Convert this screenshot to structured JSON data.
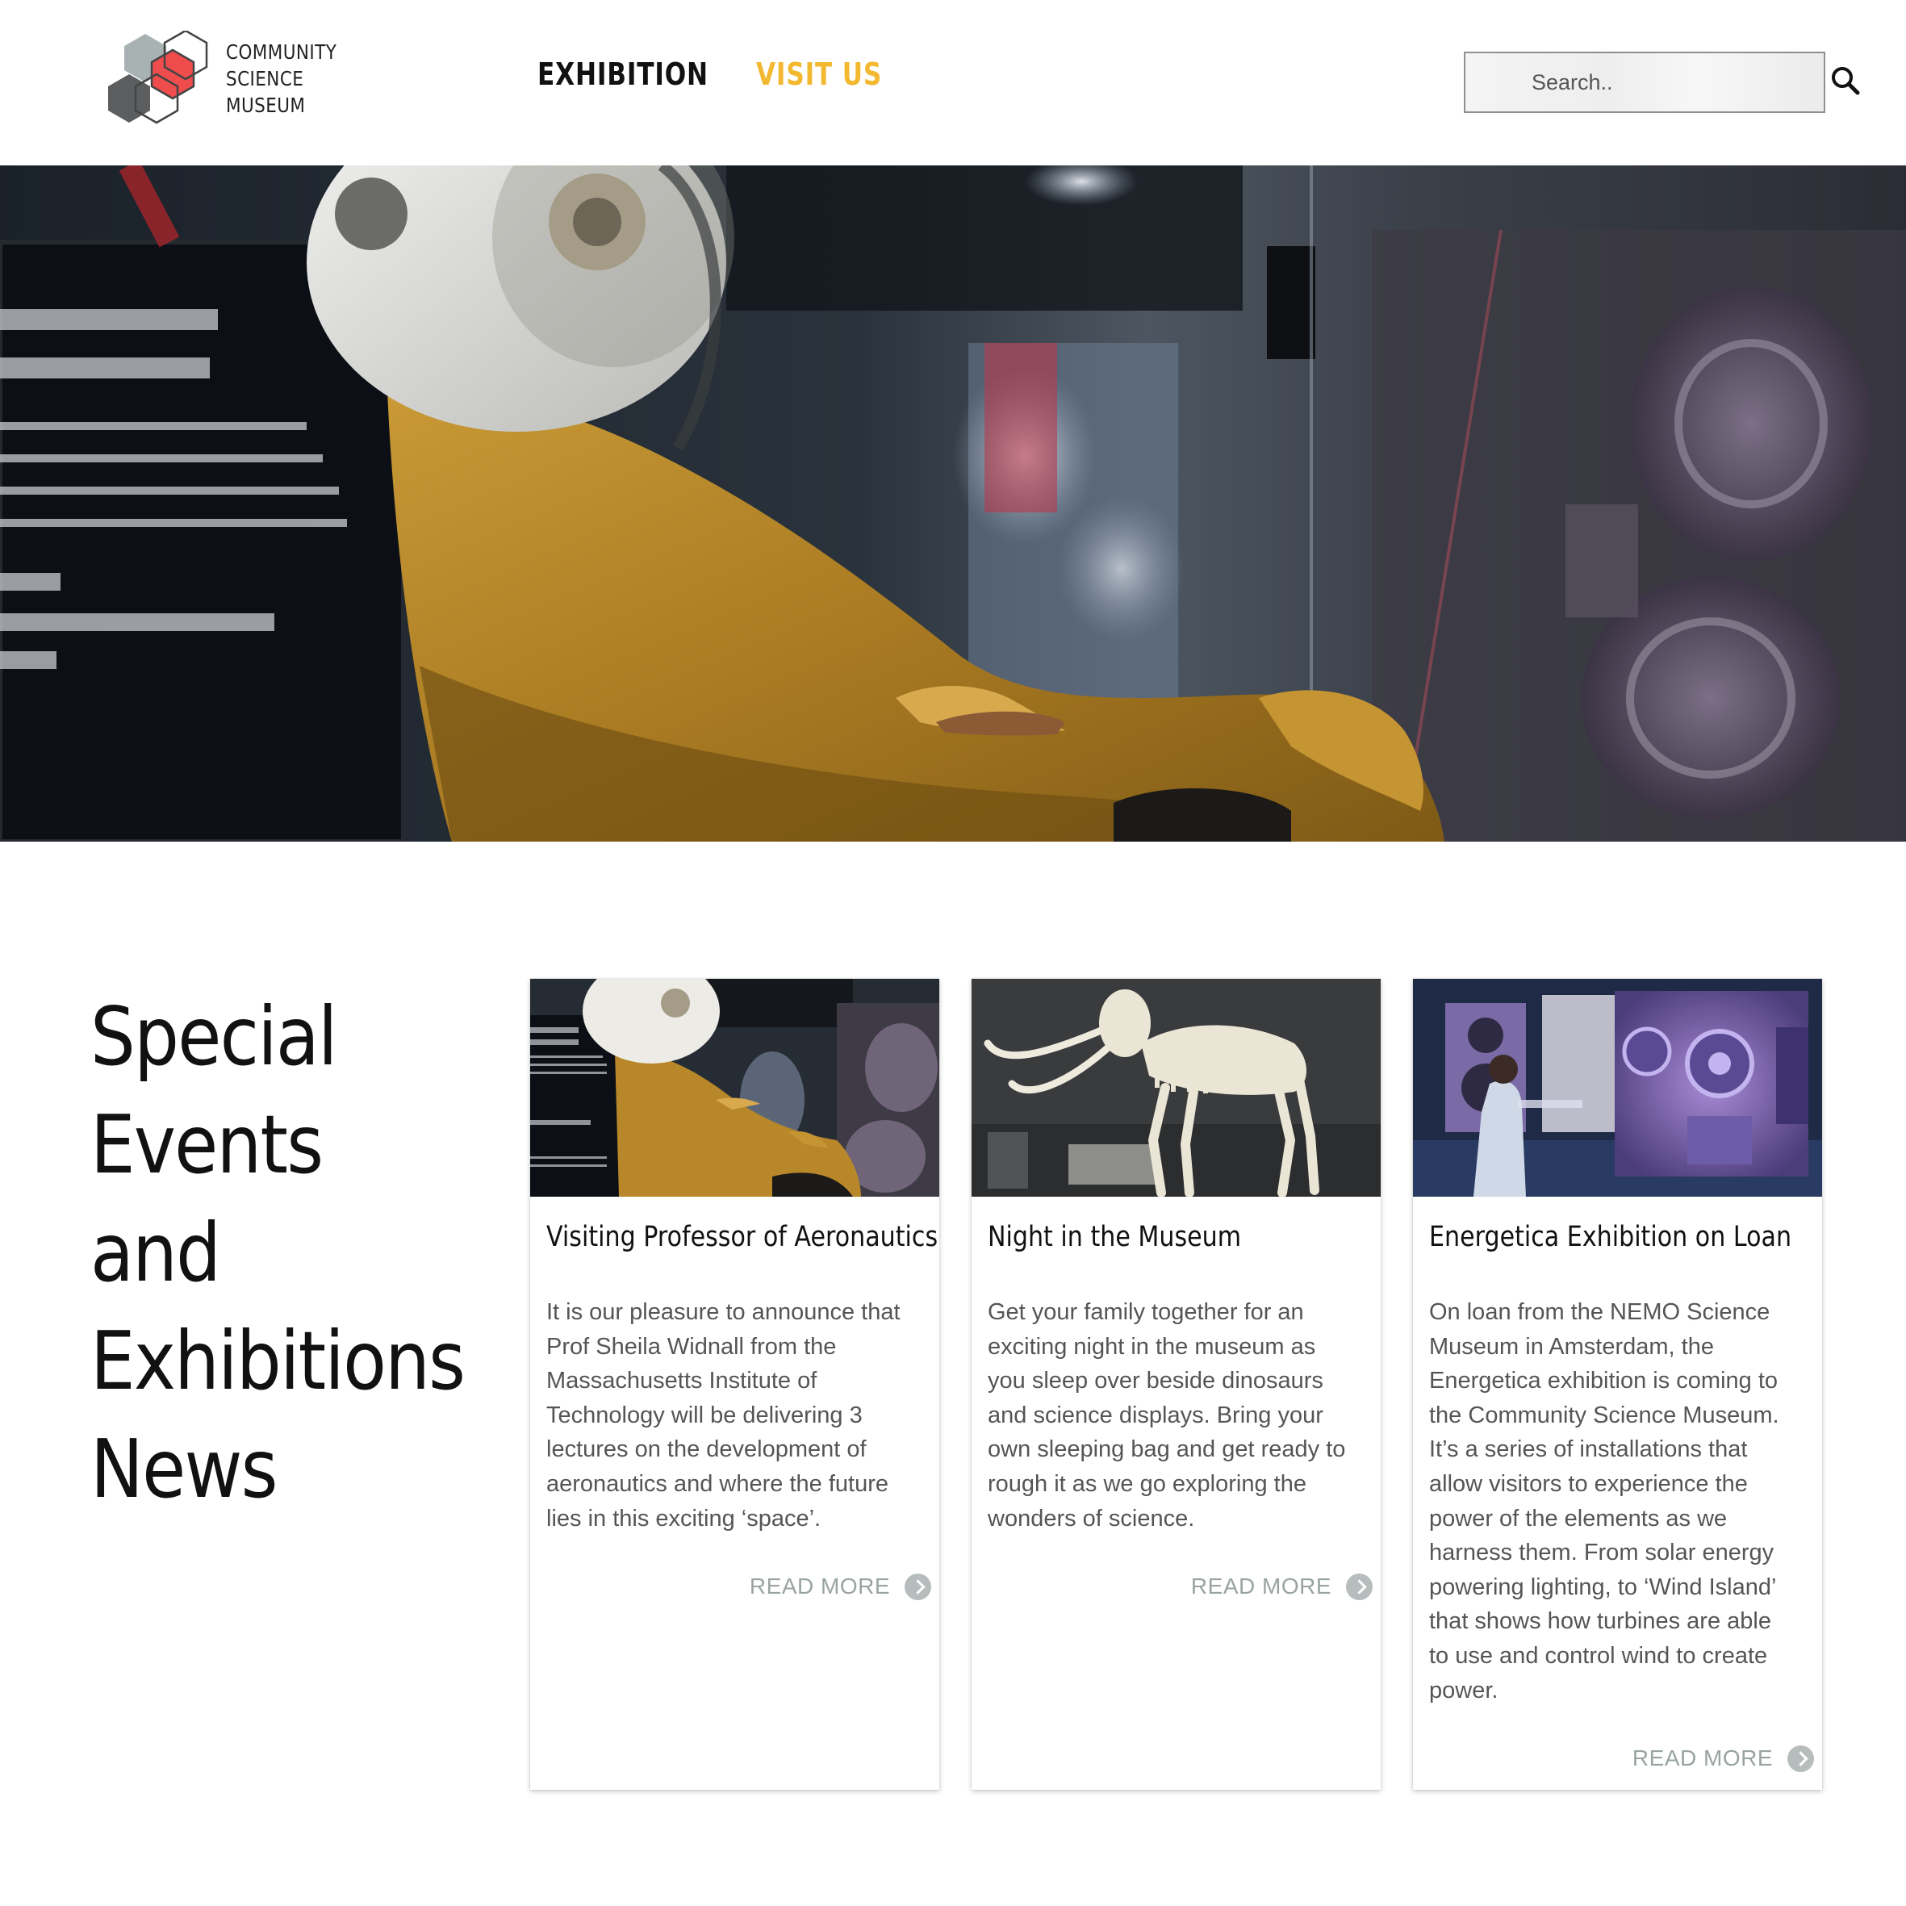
{
  "logo": {
    "lines": [
      "COMMUNITY",
      "SCIENCE",
      "MUSEUM"
    ]
  },
  "nav": {
    "exhibition": "EXHIBITION",
    "visit_us": "VISIT US"
  },
  "search": {
    "placeholder": "Search.."
  },
  "colors": {
    "accent": "#f2b830",
    "logo_red": "#ef4d4d",
    "muted_text": "#555555",
    "read_more": "#9aa3a3"
  },
  "icons": {
    "search": "search-icon",
    "read_more": "chevron-right-circle-icon"
  },
  "section": {
    "title_lines": [
      "Special",
      "Events and",
      "Exhibitions",
      "News"
    ]
  },
  "cards": [
    {
      "title": "Visiting Professor of Aeronautics",
      "body_lines": [
        "It is our pleasure to announce that",
        "Prof Sheila Widnall from the",
        "Massachusetts Institute of",
        "Technology will be delivering 3",
        "lectures on the development of",
        "aeronautics and where the future",
        "lies in this exciting ‘space’."
      ],
      "read_more": "READ MORE"
    },
    {
      "title": "Night in the Museum",
      "body_lines": [
        "Get your family together for an",
        "exciting night in the museum as",
        "you sleep over beside dinosaurs",
        "and science displays. Bring your",
        "own sleeping bag and get ready to",
        "rough it as we go exploring the",
        "wonders of science."
      ],
      "read_more": "READ MORE"
    },
    {
      "title": "Energetica Exhibition on Loan",
      "body_lines": [
        "On loan from the NEMO Science",
        "Museum in Amsterdam, the",
        "Energetica exhibition is coming to",
        "the Community Science Museum.",
        "It’s a series of installations that",
        "allow visitors to experience the",
        "power of the elements as we",
        "harness them. From solar energy",
        "powering lighting, to ‘Wind Island’",
        "that shows how turbines are able",
        "to use and control wind to create",
        "power."
      ],
      "read_more": "READ MORE"
    }
  ]
}
